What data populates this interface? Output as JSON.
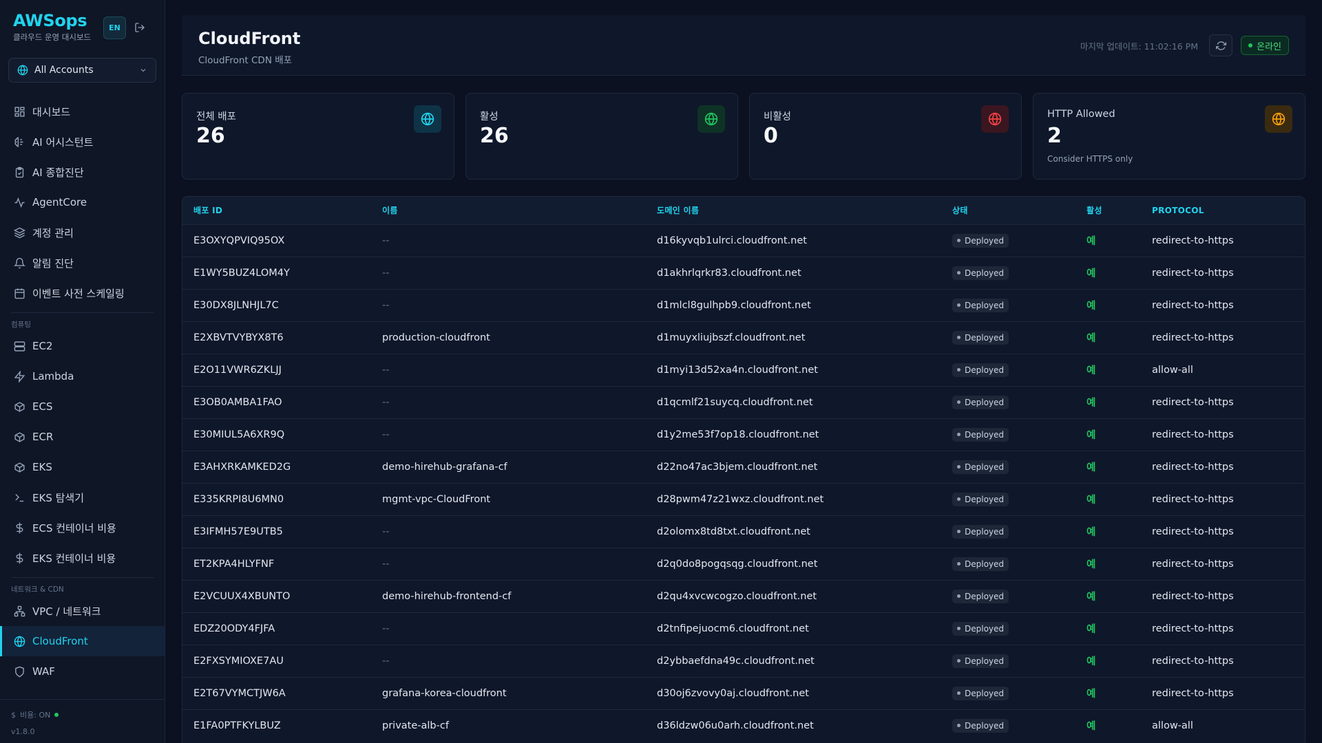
{
  "brand": {
    "title": "AWSops",
    "subtitle": "클라우드 운영 대시보드"
  },
  "lang_button": "EN",
  "account_select": {
    "label": "All Accounts"
  },
  "nav": {
    "main": [
      "대시보드",
      "AI 어시스턴트",
      "AI 종합진단",
      "AgentCore",
      "계정 관리",
      "알림 진단",
      "이벤트 사전 스케일링"
    ],
    "section_compute": "컴퓨팅",
    "compute": [
      "EC2",
      "Lambda",
      "ECS",
      "ECR",
      "EKS",
      "EKS 탐색기",
      "ECS 컨테이너 비용",
      "EKS 컨테이너 비용"
    ],
    "section_network": "네트워크 & CDN",
    "network": [
      "VPC / 네트워크",
      "CloudFront",
      "WAF"
    ]
  },
  "footer": {
    "cost": "비용: ON",
    "version": "v1.8.0"
  },
  "header": {
    "title": "CloudFront",
    "subtitle": "CloudFront CDN 배포",
    "last_updated": "마지막 업데이트: 11:02:16 PM",
    "status": "온라인"
  },
  "stats": [
    {
      "label": "전체 배포",
      "value": "26",
      "note": "",
      "color": "#22d3ee"
    },
    {
      "label": "활성",
      "value": "26",
      "note": "",
      "color": "#22c55e"
    },
    {
      "label": "비활성",
      "value": "0",
      "note": "",
      "color": "#ef4444"
    },
    {
      "label": "HTTP Allowed",
      "value": "2",
      "note": "Consider HTTPS only",
      "color": "#f59e0b"
    }
  ],
  "table": {
    "columns": [
      "배포 ID",
      "이름",
      "도메인 이름",
      "상태",
      "활성",
      "PROTOCOL"
    ],
    "rows": [
      [
        "E3OXYQPVIQ95OX",
        "--",
        "d16kyvqb1ulrci.cloudfront.net",
        "Deployed",
        "예",
        "redirect-to-https"
      ],
      [
        "E1WY5BUZ4LOM4Y",
        "--",
        "d1akhrlqrkr83.cloudfront.net",
        "Deployed",
        "예",
        "redirect-to-https"
      ],
      [
        "E30DX8JLNHJL7C",
        "--",
        "d1mlcl8gulhpb9.cloudfront.net",
        "Deployed",
        "예",
        "redirect-to-https"
      ],
      [
        "E2XBVTVYBYX8T6",
        "production-cloudfront",
        "d1muyxliujbszf.cloudfront.net",
        "Deployed",
        "예",
        "redirect-to-https"
      ],
      [
        "E2O11VWR6ZKLJJ",
        "--",
        "d1myi13d52xa4n.cloudfront.net",
        "Deployed",
        "예",
        "allow-all"
      ],
      [
        "E3OB0AMBA1FAO",
        "--",
        "d1qcmlf21suycq.cloudfront.net",
        "Deployed",
        "예",
        "redirect-to-https"
      ],
      [
        "E30MIUL5A6XR9Q",
        "--",
        "d1y2me53f7op18.cloudfront.net",
        "Deployed",
        "예",
        "redirect-to-https"
      ],
      [
        "E3AHXRKAMKED2G",
        "demo-hirehub-grafana-cf",
        "d22no47ac3bjem.cloudfront.net",
        "Deployed",
        "예",
        "redirect-to-https"
      ],
      [
        "E335KRPI8U6MN0",
        "mgmt-vpc-CloudFront",
        "d28pwm47z21wxz.cloudfront.net",
        "Deployed",
        "예",
        "redirect-to-https"
      ],
      [
        "E3IFMH57E9UTB5",
        "--",
        "d2olomx8td8txt.cloudfront.net",
        "Deployed",
        "예",
        "redirect-to-https"
      ],
      [
        "ET2KPA4HLYFNF",
        "--",
        "d2q0do8pogqsqg.cloudfront.net",
        "Deployed",
        "예",
        "redirect-to-https"
      ],
      [
        "E2VCUUX4XBUNTO",
        "demo-hirehub-frontend-cf",
        "d2qu4xvcwcogzo.cloudfront.net",
        "Deployed",
        "예",
        "redirect-to-https"
      ],
      [
        "EDZ20ODY4FJFA",
        "--",
        "d2tnfipejuocm6.cloudfront.net",
        "Deployed",
        "예",
        "redirect-to-https"
      ],
      [
        "E2FXSYMIOXE7AU",
        "--",
        "d2ybbaefdna49c.cloudfront.net",
        "Deployed",
        "예",
        "redirect-to-https"
      ],
      [
        "E2T67VYMCTJW6A",
        "grafana-korea-cloudfront",
        "d30oj6zvovy0aj.cloudfront.net",
        "Deployed",
        "예",
        "redirect-to-https"
      ],
      [
        "E1FA0PTFKYLBUZ",
        "private-alb-cf",
        "d36ldzw06u0arh.cloudfront.net",
        "Deployed",
        "예",
        "allow-all"
      ]
    ]
  }
}
